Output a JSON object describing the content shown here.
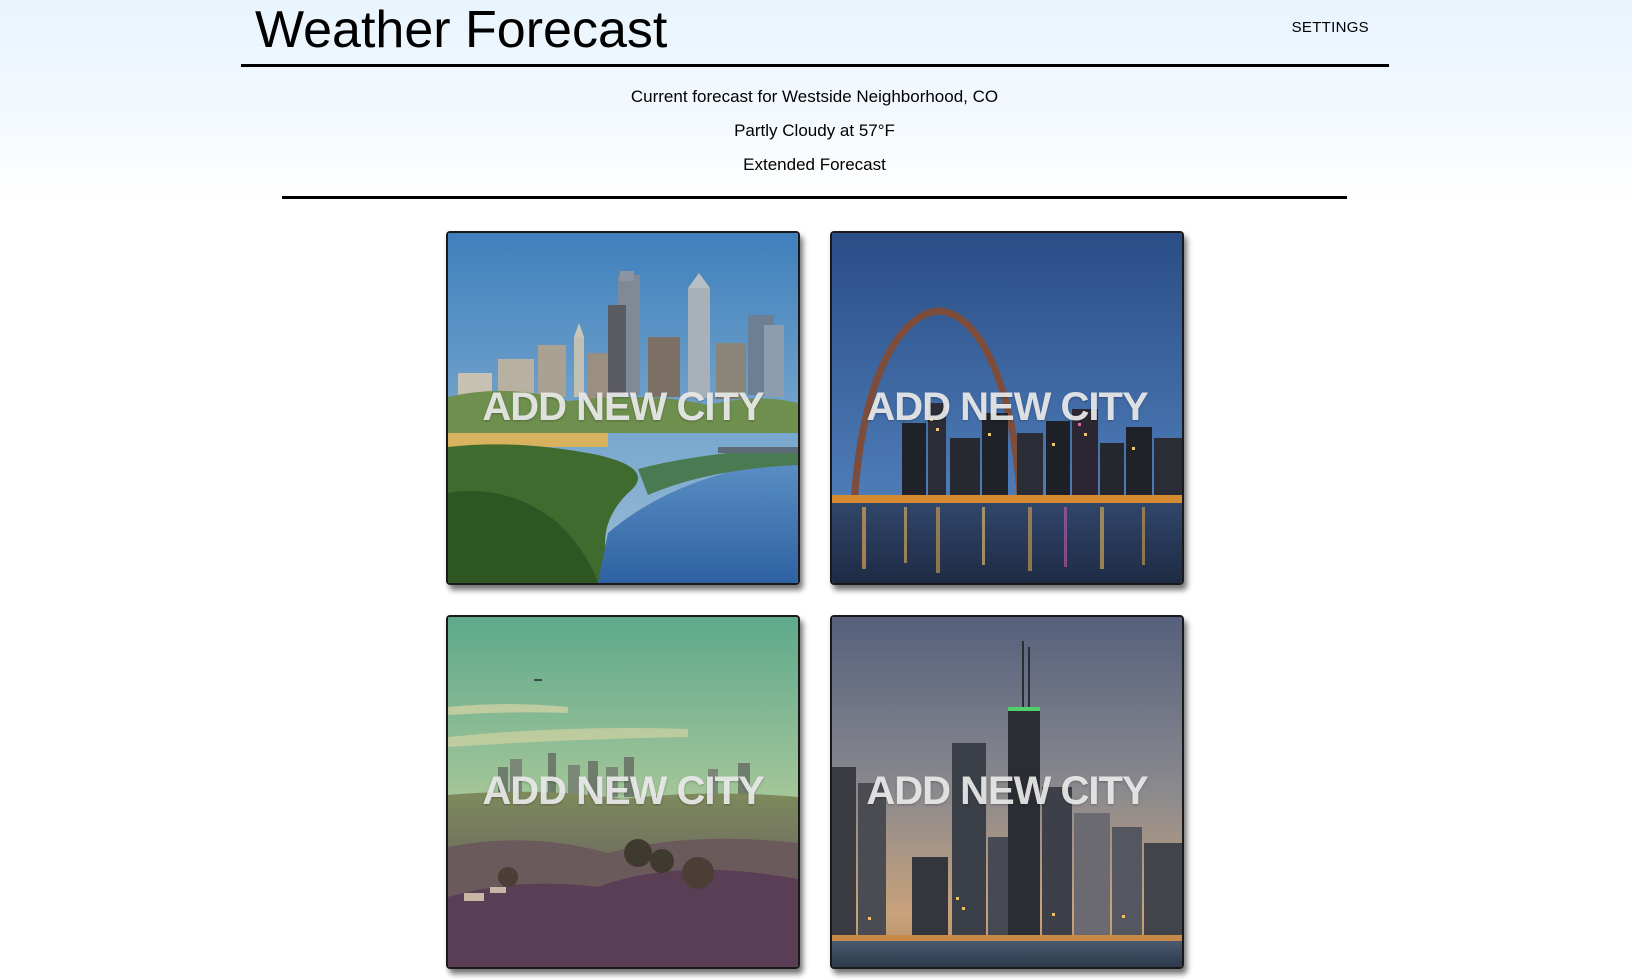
{
  "header": {
    "title": "Weather Forecast",
    "settings_label": "SETTINGS"
  },
  "current": {
    "location_line": "Current forecast for Westside Neighborhood, CO",
    "conditions_line": "Partly Cloudy at 57°F",
    "extended_link": "Extended Forecast"
  },
  "tiles": [
    {
      "label": "ADD NEW CITY",
      "scene": "philadelphia-skyline"
    },
    {
      "label": "ADD NEW CITY",
      "scene": "st-louis-arch-night"
    },
    {
      "label": "ADD NEW CITY",
      "scene": "los-angeles-hills"
    },
    {
      "label": "ADD NEW CITY",
      "scene": "chicago-skyline-dusk"
    }
  ],
  "colors": {
    "header_rule": "#000000",
    "tile_label": "#ebebeb",
    "page_top": "#e9f4fd"
  }
}
